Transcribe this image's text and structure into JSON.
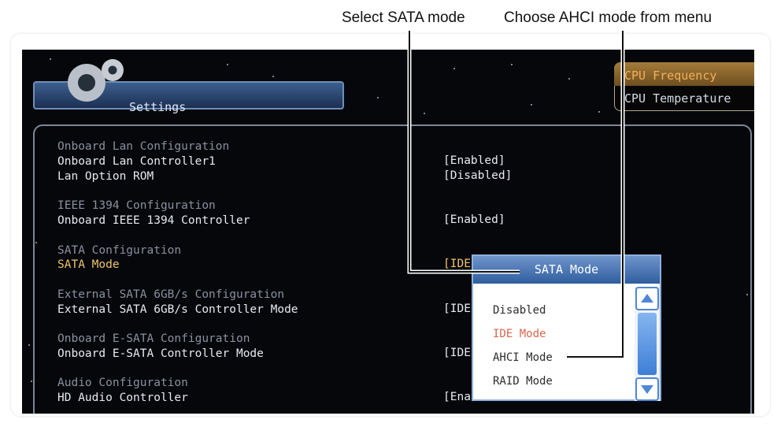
{
  "callouts": {
    "select_sata_mode": "Select SATA mode",
    "choose_ahci": "Choose AHCI mode from menu"
  },
  "bios": {
    "settings_tab": "Settings",
    "cpu_frequency": "CPU Frequency",
    "cpu_temperature": "CPU Temperature",
    "sections": {
      "onboard_lan_header": "Onboard Lan Configuration",
      "onboard_lan_controller_label": "Onboard Lan Controller1",
      "onboard_lan_controller_value": "[Enabled]",
      "lan_option_rom_label": "Lan Option ROM",
      "lan_option_rom_value": "[Disabled]",
      "ieee_header": "IEEE 1394 Configuration",
      "ieee_controller_label": "Onboard IEEE 1394 Controller",
      "ieee_controller_value": "[Enabled]",
      "sata_header": "SATA Configuration",
      "sata_mode_label": "SATA Mode",
      "sata_mode_value": "[IDE",
      "external_sata_header": "External SATA 6GB/s Configuration",
      "external_sata_controller_label": "External SATA 6GB/s Controller Mode",
      "external_sata_controller_value": "[IDE",
      "onboard_esata_header": "Onboard E-SATA Configuration",
      "onboard_esata_controller_label": "Onboard E-SATA Controller Mode",
      "onboard_esata_controller_value": "[IDE",
      "audio_header": "Audio Configuration",
      "hd_audio_controller_label": "HD Audio Controller",
      "hd_audio_controller_value": "[Ena"
    },
    "popup": {
      "title": "SATA Mode",
      "options": [
        "Disabled",
        "IDE Mode",
        "AHCI Mode",
        "RAID Mode"
      ],
      "selected_option": "IDE Mode",
      "colors": {
        "selected": "#d7664d",
        "normal": "#2c2c2c"
      }
    }
  },
  "icons": {
    "settings": "gear-icon",
    "scroll_up": "chevron-up-icon",
    "scroll_down": "chevron-down-icon"
  }
}
